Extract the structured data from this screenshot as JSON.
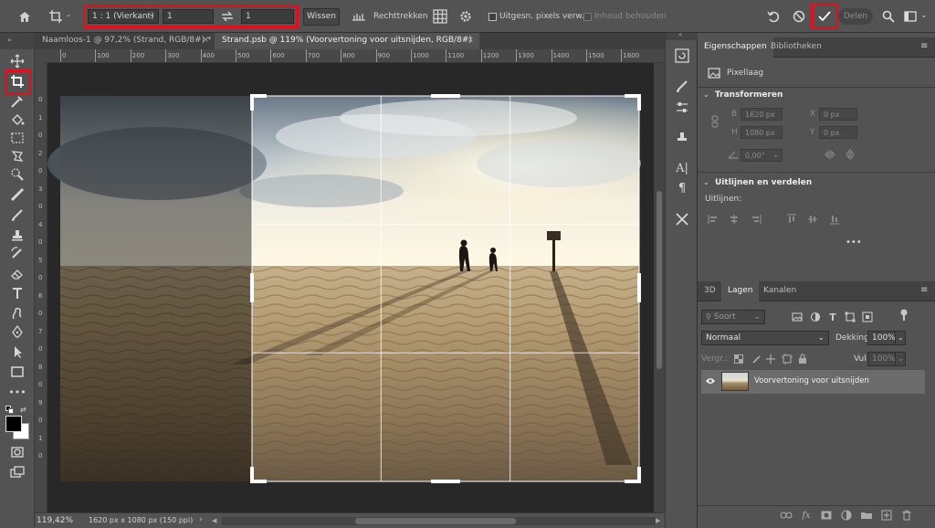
{
  "options_bar": {
    "ratio_select": "1 : 1 (Vierkant)",
    "width_value": "1",
    "height_value": "1",
    "clear_button": "Wissen",
    "straighten_label": "Rechttrekken",
    "delete_cropped_label": "Uitgesn. pixels verw.",
    "content_aware_label": "Inhoud behouden",
    "share_button": "Delen"
  },
  "tabs": [
    {
      "label": "Naamloos-1 @ 97,2% (Strand, RGB/8#) *",
      "active": false
    },
    {
      "label": "Strand.psb @ 119% (Voorvertoning voor uitsnijden, RGB/8#)",
      "active": true
    }
  ],
  "ruler_top": [
    "0",
    "100",
    "200",
    "300",
    "400",
    "500",
    "600",
    "700",
    "800",
    "900",
    "1000",
    "1100",
    "1200",
    "1300",
    "1400",
    "1500",
    "1600"
  ],
  "ruler_left": [
    "0",
    "1",
    "0",
    "2",
    "0",
    "3",
    "0",
    "4",
    "0",
    "5",
    "0",
    "6",
    "0",
    "7",
    "0",
    "8",
    "0",
    "9",
    "0",
    "1",
    "0"
  ],
  "status": {
    "zoom": "119,42%",
    "doc_info": "1620 px x 1080 px (150 ppi)"
  },
  "properties": {
    "tabs": [
      "Eigenschappen",
      "Bibliotheken"
    ],
    "layer_type": "Pixellaag",
    "transform_title": "Transformeren",
    "w_label": "B",
    "w_value": "1620 px",
    "x_label": "X",
    "x_value": "0 px",
    "h_label": "H",
    "h_value": "1080 px",
    "y_label": "Y",
    "y_value": "0 px",
    "angle_value": "0,00°",
    "align_title": "Uitlijnen en verdelen",
    "align_label": "Uitlijnen:",
    "more": "•••"
  },
  "layers": {
    "tabs": [
      "3D",
      "Lagen",
      "Kanalen"
    ],
    "filter_kind": "Soort",
    "blend_mode": "Normaal",
    "opacity_label": "Dekking:",
    "opacity_value": "100%",
    "lock_label": "Vergr.:",
    "fill_label": "Vul:",
    "fill_value": "100%",
    "layer_name": "Voorvertoning voor uitsnijden"
  },
  "colors": {
    "highlight_red": "#e0101e",
    "panel_bg": "#535353",
    "canvas_bg": "#282828"
  }
}
